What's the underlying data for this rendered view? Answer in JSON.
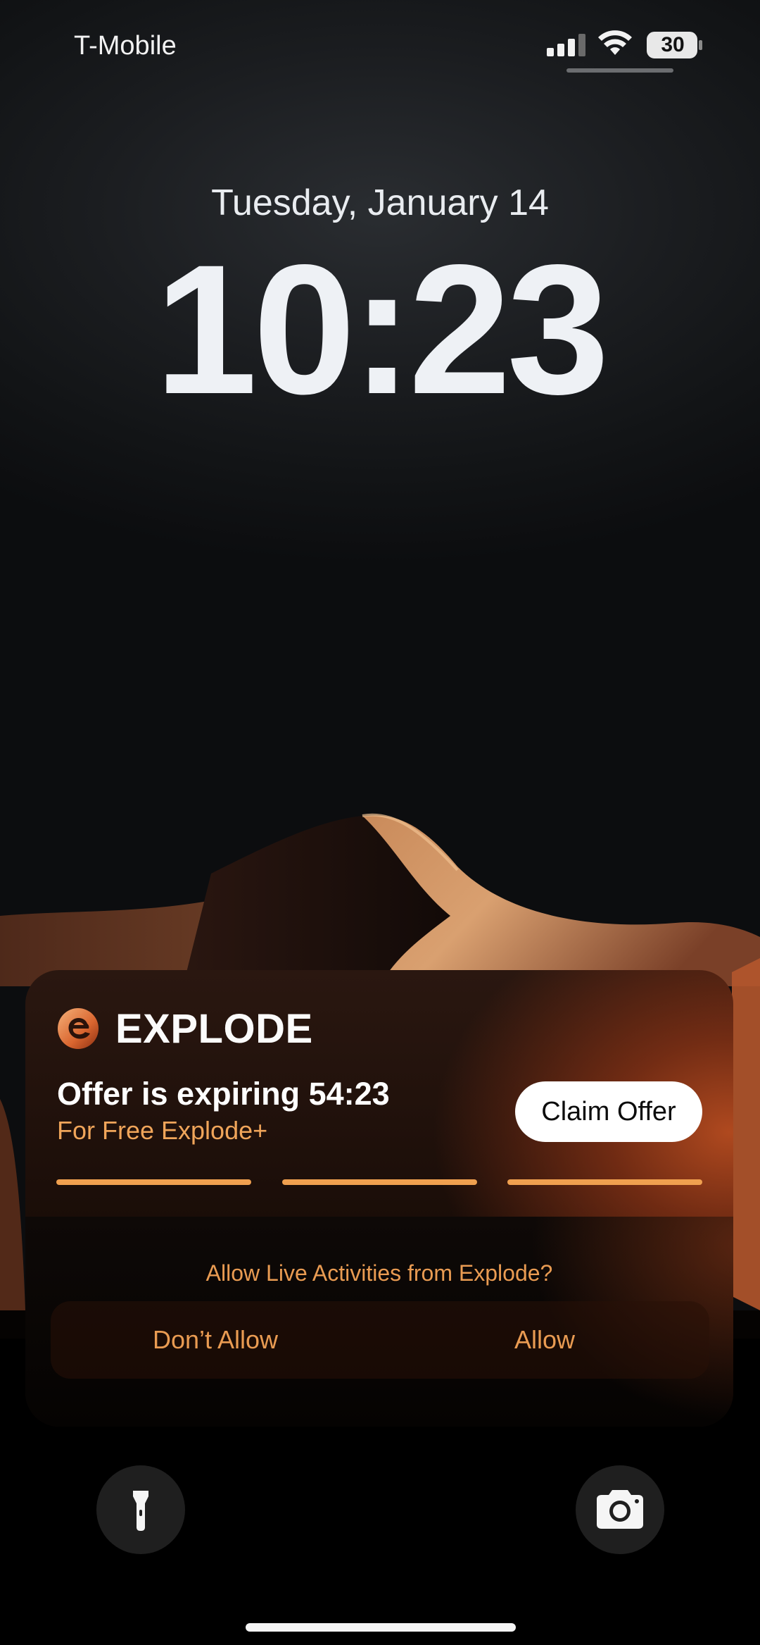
{
  "status_bar": {
    "carrier": "T-Mobile",
    "battery_percent": "30",
    "icons": [
      "signal-icon",
      "wifi-icon",
      "battery-icon"
    ]
  },
  "lock_screen": {
    "date": "Tuesday, January 14",
    "time": "10:23"
  },
  "live_activity": {
    "app_name": "EXPLODE",
    "logo_icon": "explode-logo-icon",
    "offer_title": "Offer is expiring 54:23",
    "offer_subtitle": "For Free Explode+",
    "claim_button_label": "Claim Offer",
    "progress_segments": 3,
    "accent_color": "#f0a04f",
    "permission": {
      "question": "Allow Live Activities from Explode?",
      "deny_label": "Don’t Allow",
      "allow_label": "Allow"
    }
  },
  "bottom_controls": {
    "left": "flashlight-icon",
    "right": "camera-icon"
  }
}
